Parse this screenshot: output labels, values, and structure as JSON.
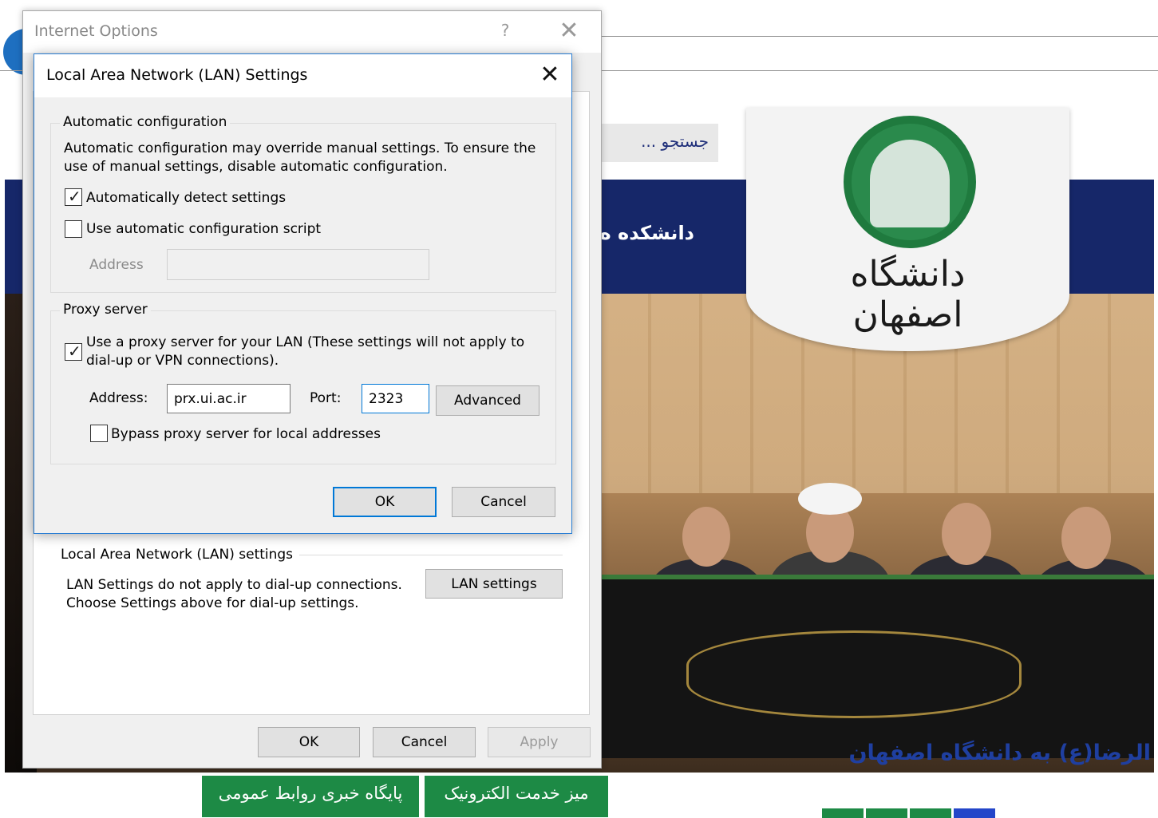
{
  "website": {
    "search_placeholder": "جستجو ...",
    "faculty_text": "دانشکده ه",
    "logo_text": "دانشگاه اصفهان",
    "headline": "الرضا(ع) به دانشگاه اصفهان",
    "bottom_buttons": [
      "میز خدمت الکترونیک",
      "پایگاه خبری روابط عمومی"
    ],
    "colors": {
      "navy": "#162769",
      "green": "#1d8a45",
      "headline": "#1f3fa0"
    }
  },
  "internet_options": {
    "title": "Internet Options",
    "help": "?",
    "close": "✕",
    "lan_group_label": "Local Area Network (LAN) settings",
    "lan_desc": "LAN Settings do not apply to dial-up connections.\nChoose Settings above for dial-up settings.",
    "lan_settings_button": "LAN settings",
    "ok": "OK",
    "cancel": "Cancel",
    "apply": "Apply"
  },
  "lan_dialog": {
    "title": "Local Area Network (LAN) Settings",
    "close": "✕",
    "auto_config": {
      "label": "Automatic configuration",
      "description": "Automatic configuration may override manual settings.  To ensure the use of manual settings, disable automatic configuration.",
      "auto_detect": {
        "label": "Automatically detect settings",
        "checked": true
      },
      "auto_script": {
        "label": "Use automatic configuration script",
        "checked": false
      },
      "address_label": "Address",
      "address_value": ""
    },
    "proxy": {
      "label": "Proxy server",
      "use_proxy": {
        "label": "Use a proxy server for your LAN (These settings will not apply to dial-up or VPN connections).",
        "checked": true
      },
      "address_label": "Address:",
      "address_value": "prx.ui.ac.ir",
      "port_label": "Port:",
      "port_value": "2323",
      "advanced": "Advanced",
      "bypass": {
        "label": "Bypass proxy server for local addresses",
        "checked": false
      }
    },
    "ok": "OK",
    "cancel": "Cancel"
  }
}
